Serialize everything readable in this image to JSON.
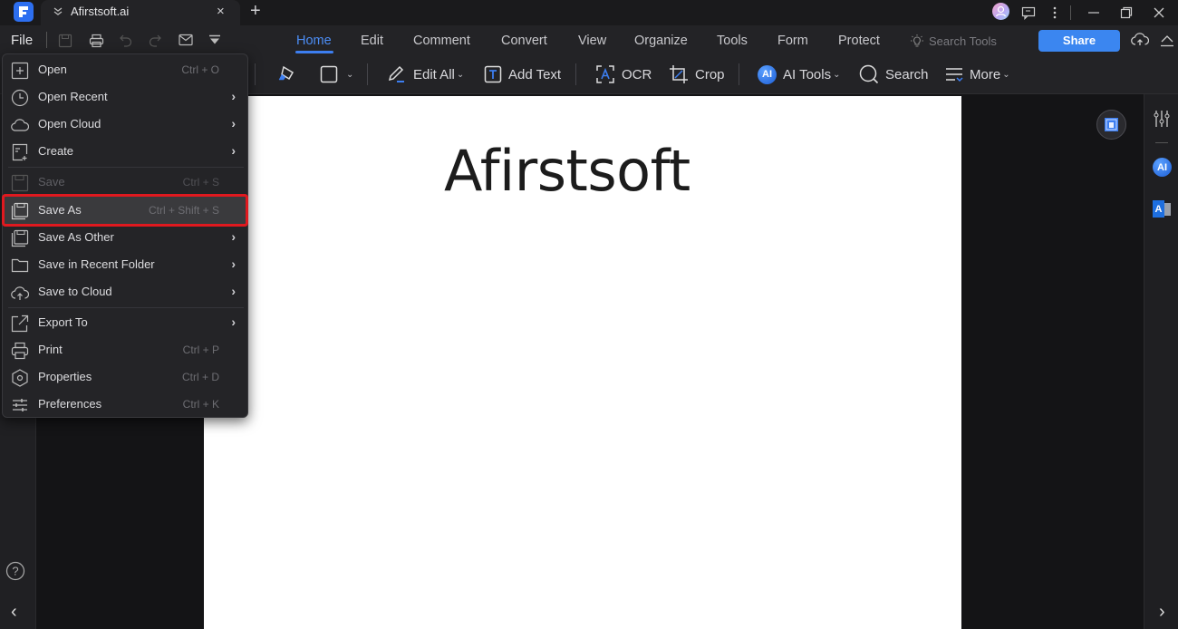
{
  "titlebar": {
    "tab_title": "Afirstsoft.ai",
    "close_glyph": "×",
    "new_tab_glyph": "+"
  },
  "menubar": {
    "file_label": "File",
    "tabs": [
      {
        "label": "Home",
        "active": true
      },
      {
        "label": "Edit"
      },
      {
        "label": "Comment"
      },
      {
        "label": "Convert"
      },
      {
        "label": "View"
      },
      {
        "label": "Organize"
      },
      {
        "label": "Tools"
      },
      {
        "label": "Form"
      },
      {
        "label": "Protect"
      }
    ],
    "search_tools_placeholder": "Search Tools",
    "share_label": "Share"
  },
  "toolbar": {
    "edit_all": "Edit All",
    "add_text": "Add Text",
    "ocr": "OCR",
    "crop": "Crop",
    "ai_tools": "AI Tools",
    "ai_badge": "AI",
    "search": "Search",
    "more": "More"
  },
  "file_menu": {
    "items": [
      {
        "label": "Open",
        "shortcut": "Ctrl + O",
        "icon": "open-plus-icon"
      },
      {
        "label": "Open Recent",
        "submenu": true,
        "icon": "clock-icon"
      },
      {
        "label": "Open Cloud",
        "submenu": true,
        "icon": "cloud-icon"
      },
      {
        "label": "Create",
        "submenu": true,
        "icon": "create-doc-icon"
      },
      {
        "label": "Save",
        "shortcut": "Ctrl + S",
        "disabled": true,
        "icon": "save-icon"
      },
      {
        "label": "Save As",
        "shortcut": "Ctrl + Shift + S",
        "highlighted": true,
        "icon": "save-as-icon"
      },
      {
        "label": "Save As Other",
        "submenu": true,
        "icon": "save-as-other-icon"
      },
      {
        "label": "Save in Recent Folder",
        "submenu": true,
        "icon": "folder-icon"
      },
      {
        "label": "Save to Cloud",
        "submenu": true,
        "icon": "cloud-upload-icon"
      },
      {
        "label": "Export To",
        "submenu": true,
        "icon": "export-icon"
      },
      {
        "label": "Print",
        "shortcut": "Ctrl + P",
        "icon": "print-icon"
      },
      {
        "label": "Properties",
        "shortcut": "Ctrl + D",
        "icon": "properties-icon"
      },
      {
        "label": "Preferences",
        "shortcut": "Ctrl + K",
        "icon": "preferences-icon"
      }
    ],
    "submenu_glyph": "›"
  },
  "document": {
    "text": "Afirstsoft"
  },
  "right_rail": {
    "ai_badge": "AI",
    "translate_badge": "A"
  },
  "bottom": {
    "help_glyph": "?",
    "collapse_left_glyph": "‹",
    "expand_right_glyph": "›"
  },
  "colors": {
    "accent": "#3b86f0",
    "active_tab": "#4c8df5",
    "highlight_outline": "#e0191f",
    "menu_bg": "#242427",
    "page_bg": "#ffffff"
  }
}
